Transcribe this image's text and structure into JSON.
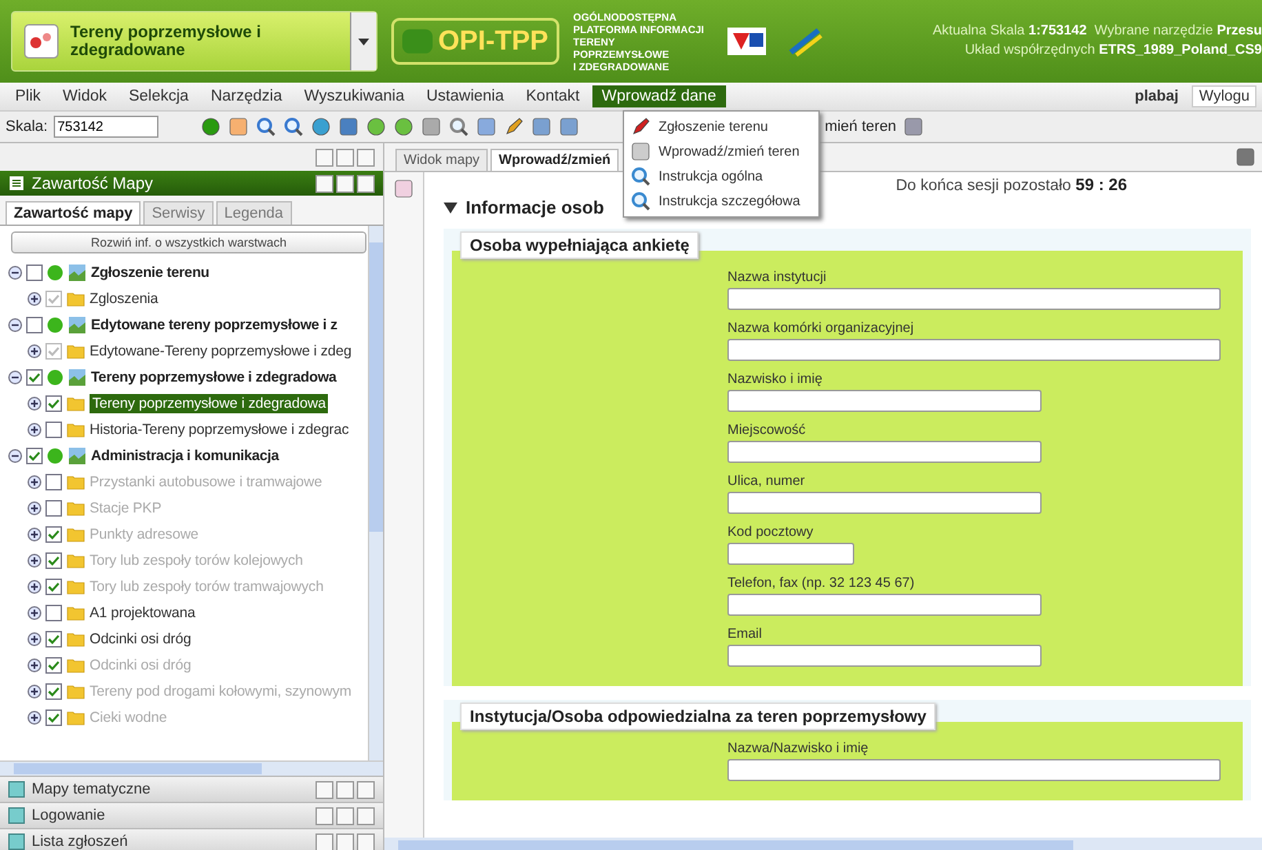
{
  "header": {
    "map_select": "Tereny poprzemysłowe i zdegradowane",
    "logo": "OPI-TPP",
    "platform_lines": [
      "OGÓLNODOSTĘPNA",
      "PLATFORMA INFORMACJI",
      "TERENY POPRZEMYSŁOWE",
      "I ZDEGRADOWANE"
    ],
    "scale_label": "Aktualna Skala",
    "scale_value": "1:753142",
    "tool_label": "Wybrane narzędzie",
    "tool_value": "Przesu",
    "crs_label": "Układ współrzędnych",
    "crs_value": "ETRS_1989_Poland_CS9"
  },
  "menu": {
    "items": [
      {
        "label": "Plik",
        "selected": false
      },
      {
        "label": "Widok",
        "selected": false
      },
      {
        "label": "Selekcja",
        "selected": false
      },
      {
        "label": "Narzędzia",
        "selected": false
      },
      {
        "label": "Wyszukiwania",
        "selected": false
      },
      {
        "label": "Ustawienia",
        "selected": false
      },
      {
        "label": "Kontakt",
        "selected": false
      },
      {
        "label": "Wprowadź dane",
        "selected": true
      }
    ],
    "user": "plabaj",
    "logout": "Wylogu"
  },
  "toolbar": {
    "scale_label": "Skala:",
    "scale_value": "753142",
    "partial_label": "mień teren"
  },
  "dropdown": [
    {
      "label": "Zgłoszenie terenu"
    },
    {
      "label": "Wprowadź/zmień teren"
    },
    {
      "label": "Instrukcja ogólna"
    },
    {
      "label": "Instrukcja szczegółowa"
    }
  ],
  "left_panel": {
    "title": "Zawartość Mapy",
    "tabs": [
      {
        "label": "Zawartość mapy",
        "selected": true
      },
      {
        "label": "Serwisy",
        "selected": false
      },
      {
        "label": "Legenda",
        "selected": false
      }
    ],
    "expand_button": "Rozwiń inf. o wszystkich warstwach",
    "tree": [
      {
        "label": "Zgłoszenie terenu",
        "checked": false,
        "expanded": true,
        "children": [
          {
            "label": "Zgloszenia",
            "checked": true,
            "disabled": true,
            "dimmed": false,
            "selected": false
          }
        ]
      },
      {
        "label": "Edytowane tereny poprzemysłowe i z",
        "checked": false,
        "expanded": true,
        "children": [
          {
            "label": "Edytowane-Tereny poprzemysłowe i zdeg",
            "checked": true,
            "disabled": true,
            "dimmed": false,
            "selected": false
          }
        ]
      },
      {
        "label": "Tereny poprzemysłowe i zdegradowa",
        "checked": true,
        "expanded": true,
        "children": [
          {
            "label": "Tereny poprzemysłowe i zdegradowa",
            "checked": true,
            "disabled": false,
            "dimmed": false,
            "selected": true
          },
          {
            "label": "Historia-Tereny poprzemysłowe i zdegrac",
            "checked": false,
            "disabled": false,
            "dimmed": false,
            "selected": false
          }
        ]
      },
      {
        "label": "Administracja i komunikacja",
        "checked": true,
        "expanded": true,
        "children": [
          {
            "label": "Przystanki autobusowe i tramwajowe",
            "checked": false,
            "disabled": false,
            "dimmed": true,
            "selected": false
          },
          {
            "label": "Stacje PKP",
            "checked": false,
            "disabled": false,
            "dimmed": true,
            "selected": false
          },
          {
            "label": "Punkty adresowe",
            "checked": true,
            "disabled": false,
            "dimmed": true,
            "selected": false
          },
          {
            "label": "Tory lub zespoły torów kolejowych",
            "checked": true,
            "disabled": false,
            "dimmed": true,
            "selected": false
          },
          {
            "label": "Tory lub zespoły torów tramwajowych",
            "checked": true,
            "disabled": false,
            "dimmed": true,
            "selected": false
          },
          {
            "label": "A1 projektowana",
            "checked": false,
            "disabled": false,
            "dimmed": false,
            "selected": false
          },
          {
            "label": "Odcinki osi dróg",
            "checked": true,
            "disabled": false,
            "dimmed": false,
            "selected": false
          },
          {
            "label": "Odcinki osi dróg",
            "checked": true,
            "disabled": false,
            "dimmed": true,
            "selected": false
          },
          {
            "label": "Tereny pod drogami kołowymi, szynowym",
            "checked": true,
            "disabled": false,
            "dimmed": true,
            "selected": false
          },
          {
            "label": "Cieki wodne",
            "checked": true,
            "disabled": false,
            "dimmed": true,
            "selected": false
          }
        ]
      }
    ],
    "panels": [
      {
        "label": "Mapy tematyczne"
      },
      {
        "label": "Logowanie"
      },
      {
        "label": "Lista zgłoszeń"
      }
    ]
  },
  "main": {
    "tabs": [
      {
        "label": "Widok mapy",
        "selected": false
      },
      {
        "label": "Wprowadź/zmień",
        "selected": true
      }
    ],
    "session_text": "Do końca sesji pozostało",
    "session_time": "59 : 26",
    "section_title": "Informacje osob",
    "fieldsets": [
      {
        "legend": "Osoba wypełniająca ankietę",
        "fields": [
          {
            "label": "Nazwa instytucji",
            "kind": "wide"
          },
          {
            "label": "Nazwa komórki organizacyjnej",
            "kind": "wide"
          },
          {
            "label": "Nazwisko i imię",
            "kind": "medium"
          },
          {
            "label": "Miejscowość",
            "kind": "medium"
          },
          {
            "label": "Ulica, numer",
            "kind": "medium"
          },
          {
            "label": "Kod pocztowy",
            "kind": "short"
          },
          {
            "label": "Telefon, fax (np. 32 123 45 67)",
            "kind": "medium"
          },
          {
            "label": "Email",
            "kind": "medium"
          }
        ]
      },
      {
        "legend": "Instytucja/Osoba odpowiedzialna za teren poprzemysłowy",
        "fields": [
          {
            "label": "Nazwa/Nazwisko i imię",
            "kind": "wide"
          }
        ]
      }
    ]
  }
}
